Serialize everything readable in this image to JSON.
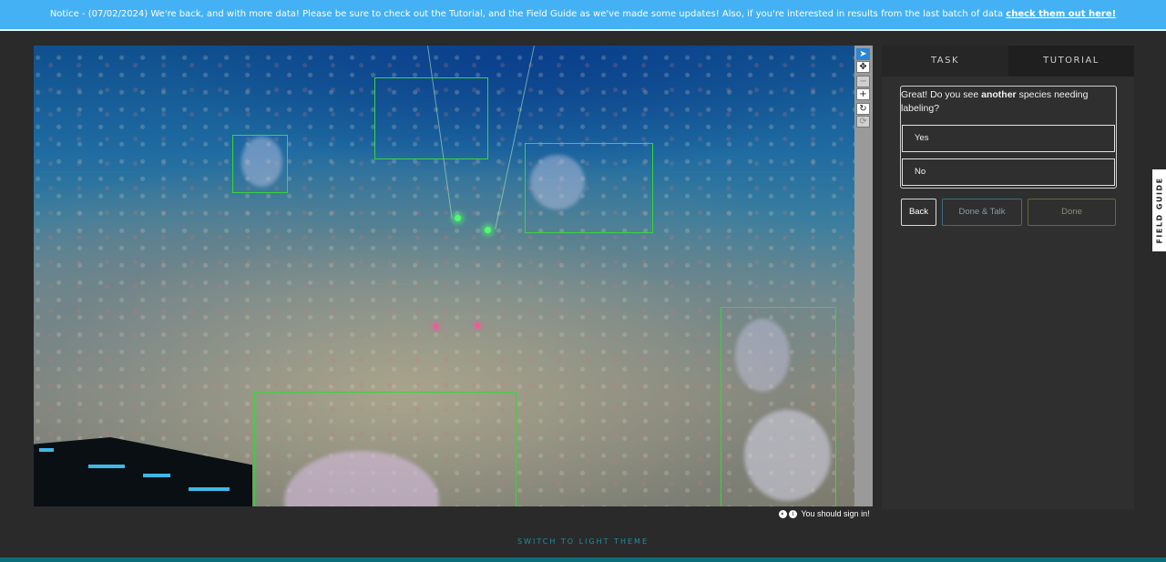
{
  "notice": {
    "text": "Notice - (07/02/2024) We're back, and with more data! Please be sure to check out the Tutorial, and the Field Guide as we've made some updates! Also, if you're interested in results from the last batch of data ",
    "link": "check them out here!"
  },
  "viewer": {
    "image_alt": "underwater seafloor image with sponges",
    "toolbar": [
      {
        "name": "pointer-tool",
        "glyph": "➤",
        "state": "active"
      },
      {
        "name": "move-tool",
        "glyph": "✥",
        "state": "normal"
      },
      {
        "name": "zoom-out-tool",
        "glyph": "−",
        "state": "disabled"
      },
      {
        "name": "zoom-in-tool",
        "glyph": "+",
        "state": "normal"
      },
      {
        "name": "rotate-tool",
        "glyph": "↻",
        "state": "normal"
      },
      {
        "name": "reset-tool",
        "glyph": "⟳",
        "state": "disabled"
      }
    ],
    "signin_text": "You should sign in!"
  },
  "panel": {
    "tabs": {
      "task": "TASK",
      "tutorial": "TUTORIAL"
    },
    "question_prefix": "Great! Do you see ",
    "question_bold": "another",
    "question_suffix": " species needing labeling?",
    "answers": {
      "yes": "Yes",
      "no": "No"
    },
    "buttons": {
      "back": "Back",
      "done_talk": "Done & Talk",
      "done": "Done"
    }
  },
  "field_guide_label": "FIELD GUIDE",
  "theme_switch_label": "SWITCH TO LIGHT THEME",
  "colors": {
    "notice_bg": "#43b1f4",
    "bbox": "#37d63a",
    "panel_bg": "#2f2f2f",
    "page_bg": "#2a2a2a"
  }
}
